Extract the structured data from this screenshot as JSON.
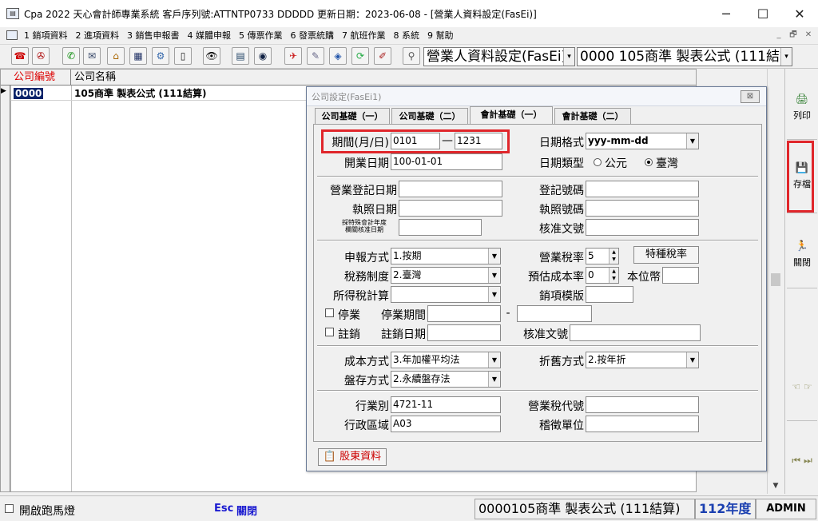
{
  "window": {
    "title": "Cpa 2022  天心會計師專業系統  客戶序列號:ATTNTP0733 DDDDD  更新日期：2023-06-08 - [營業人資料設定(FasEi)]",
    "app_icon": "cpa-app-icon",
    "minimize": "─",
    "maximize": "☐",
    "close": "✕"
  },
  "menu": {
    "items": [
      "1 銷項資料",
      "2 進項資料",
      "3 銷售申報書",
      "4 媒體申報",
      "5 傳票作業",
      "6 發票統購",
      "7 航班作業",
      "8 系統",
      "9 幫助"
    ],
    "mdi_min": "_",
    "mdi_restore": "🗗",
    "mdi_close": "✕"
  },
  "toolbar": {
    "icons": [
      "☎",
      "✇",
      "✆",
      "✉",
      "⌂",
      "▦",
      "⚙",
      "▯",
      "👁",
      "▤",
      "◉",
      "✈",
      "✎",
      "◈",
      "⟳",
      "✐",
      "⚲"
    ],
    "combo_form": "營業人資料設定(FasEi)",
    "combo_company": "0000  105商準 製表公式 (111結算",
    "arrow": "▾"
  },
  "grid": {
    "columns": [
      "公司編號",
      "公司名稱"
    ],
    "rows": [
      {
        "id": "0000",
        "name": "105商準 製表公式 (111結算)"
      }
    ],
    "indicator": "▶"
  },
  "sidebar": {
    "print_label": "列印",
    "save_label": "存檔",
    "close_label": "關閉"
  },
  "dialog": {
    "title": "公司設定(FasEi1)",
    "close": "⊠",
    "tabs": [
      "公司基礎（一）",
      "公司基礎（二）",
      "會計基礎（一）",
      "會計基礎（二）"
    ],
    "period_label": "期間(月/日)",
    "period_from": "0101",
    "period_dash": "—",
    "period_to": "1231",
    "date_format_label": "日期格式",
    "date_format_value": "yyy-mm-dd",
    "start_date_label": "開業日期",
    "start_date_value": "100-01-01",
    "date_type_label": "日期類型",
    "date_type_options": [
      "公元",
      "臺灣"
    ],
    "reg_date_label": "營業登記日期",
    "reg_no_label": "登記號碼",
    "license_date_label": "執照日期",
    "license_no_label": "執照號碼",
    "special_fy_label_1": "採特殊會計年度",
    "special_fy_label_2": "欄關核准日期",
    "approval_no_label": "核准文號",
    "filing_method_label": "申報方式",
    "filing_method_value": "1.按期",
    "tax_rate_label": "營業稅率",
    "tax_rate_value": "5",
    "special_tax_button": "特種稅率",
    "tax_system_label": "稅務制度",
    "tax_system_value": "2.臺灣",
    "est_cost_label": "預估成本率",
    "est_cost_value": "0",
    "currency_label": "本位幣",
    "income_tax_label": "所得稅計算",
    "sales_template_label": "銷項模版",
    "suspend_label": "停業",
    "suspend_period_label": "停業期間",
    "suspend_dash": "-",
    "cancel_label": "註銷",
    "cancel_date_label": "註銷日期",
    "cancel_approval_label": "核准文號",
    "cost_method_label": "成本方式",
    "cost_method_value": "3.年加權平均法",
    "depr_method_label": "折舊方式",
    "depr_method_value": "2.按年折",
    "inventory_label": "盤存方式",
    "inventory_value": "2.永續盤存法",
    "industry_label": "行業別",
    "industry_value": "4721-11",
    "tax_code_label": "營業稅代號",
    "district_label": "行政區域",
    "district_value": "A03",
    "tax_office_label": "稽徵單位",
    "shareholders_button": "股東資料"
  },
  "statusbar": {
    "marquee_label": "開啟跑馬燈",
    "esc_label": "Esc",
    "close_label": "關閉",
    "company": "0000105商準 製表公式 (111結算)",
    "year": "112年度",
    "user": "ADMIN"
  },
  "colors": {
    "accent_red": "#e0262b",
    "year_blue": "#1a3fb0",
    "esc_blue": "#1a1ad0"
  }
}
